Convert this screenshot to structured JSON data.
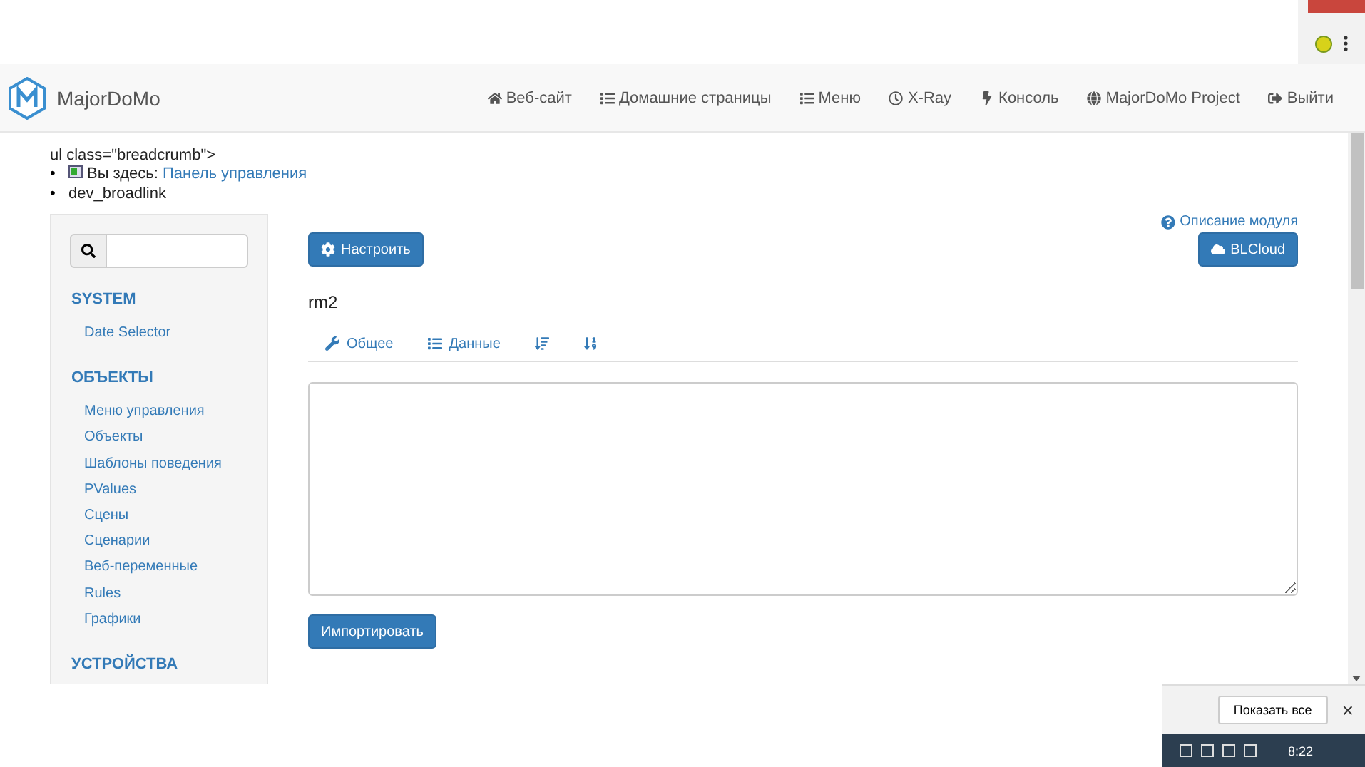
{
  "brand": {
    "name": "MajorDoMo"
  },
  "nav": [
    {
      "label": "Веб-сайт"
    },
    {
      "label": "Домашние страницы"
    },
    {
      "label": "Меню"
    },
    {
      "label": "X-Ray"
    },
    {
      "label": "Консоль"
    },
    {
      "label": "MajorDoMo Project"
    },
    {
      "label": "Выйти"
    }
  ],
  "breadcrumb": {
    "raw": "ul class=\"breadcrumb\">",
    "bullet": "•",
    "prefix": "Вы здесь:",
    "link": "Панель управления",
    "current": "dev_broadlink"
  },
  "sidebar": {
    "sections": [
      {
        "title": "SYSTEM",
        "items": [
          "Date Selector"
        ]
      },
      {
        "title": "ОБЪЕКТЫ",
        "items": [
          "Меню управления",
          "Объекты",
          "Шаблоны поведения",
          "PValues",
          "Сцены",
          "Сценарии",
          "Веб-переменные",
          "Rules",
          "Графики"
        ]
      },
      {
        "title": "УСТРОЙСТВА"
      }
    ]
  },
  "module_help": "Описание модуля",
  "configure_button": "Настроить",
  "cloud_button": "BLCloud",
  "device_title": "rm2",
  "tabs": [
    {
      "kind": "labeled",
      "label": "Общее"
    },
    {
      "kind": "labeled",
      "label": "Данные"
    },
    {
      "kind": "sort"
    },
    {
      "kind": "sortnum"
    }
  ],
  "import_button": "Импортировать",
  "downloads": {
    "show_all": "Показать все",
    "close": "×"
  },
  "taskbar": {
    "time": "8:22"
  }
}
